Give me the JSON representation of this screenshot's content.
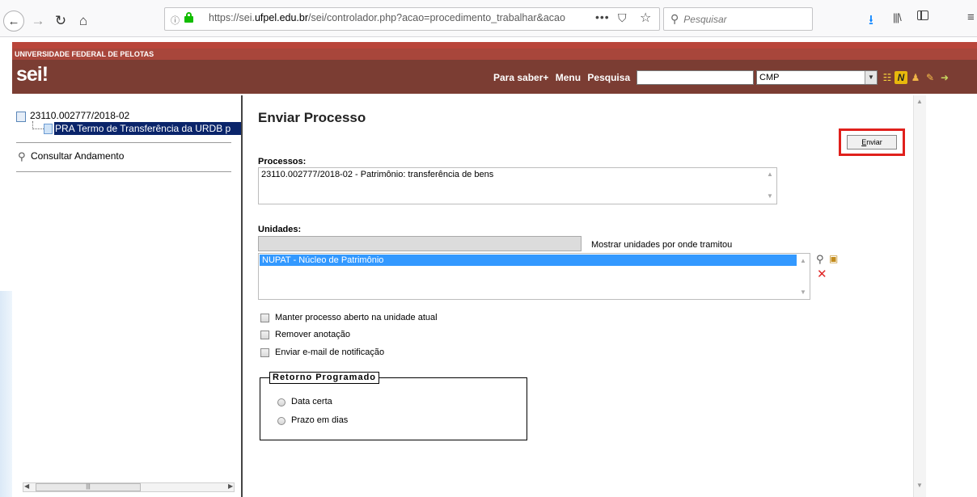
{
  "browser": {
    "url_prefix": "https://sei.",
    "url_domain": "ufpel.edu.br",
    "url_suffix": "/sei/controlador.php?acao=procedimento_trabalhar&acao",
    "search_placeholder": "Pesquisar"
  },
  "header": {
    "university": "UNIVERSIDADE FEDERAL DE PELOTAS",
    "logo": "sei",
    "logo_mark": "!",
    "nav": [
      "Para saber+",
      "Menu",
      "Pesquisa"
    ],
    "search_value": "",
    "unit_selected": "CMP",
    "note_icon_letter": "N"
  },
  "tree": {
    "process_number": "23110.002777/2018-02",
    "document": "PRA Termo de Transferência da URDB p",
    "consultar": "Consultar Andamento"
  },
  "form": {
    "title": "Enviar Processo",
    "send_button_prefix": "",
    "send_button_underlined": "E",
    "send_button_rest": "nviar",
    "processos_label": "Processos:",
    "processos_value": "23110.002777/2018-02 - Patrimônio: transferência de bens",
    "unidades_label": "Unidades:",
    "unit_input_value": "",
    "show_units_link": "Mostrar unidades por onde tramitou",
    "selected_unit": "NUPAT - Núcleo de Patrimônio",
    "options": {
      "keep_open": "Manter processo aberto na unidade atual",
      "remove_note": "Remover anotação",
      "send_email": "Enviar e-mail de notificação"
    },
    "retorno": {
      "legend": "Retorno Programado",
      "data_certa": "Data certa",
      "prazo_dias": "Prazo em dias"
    }
  },
  "colors": {
    "header_dark": "#7b3d33",
    "header_red": "#a8463b",
    "selection": "#0a246a",
    "list_selection": "#3399ff",
    "highlight": "#e0201c"
  }
}
